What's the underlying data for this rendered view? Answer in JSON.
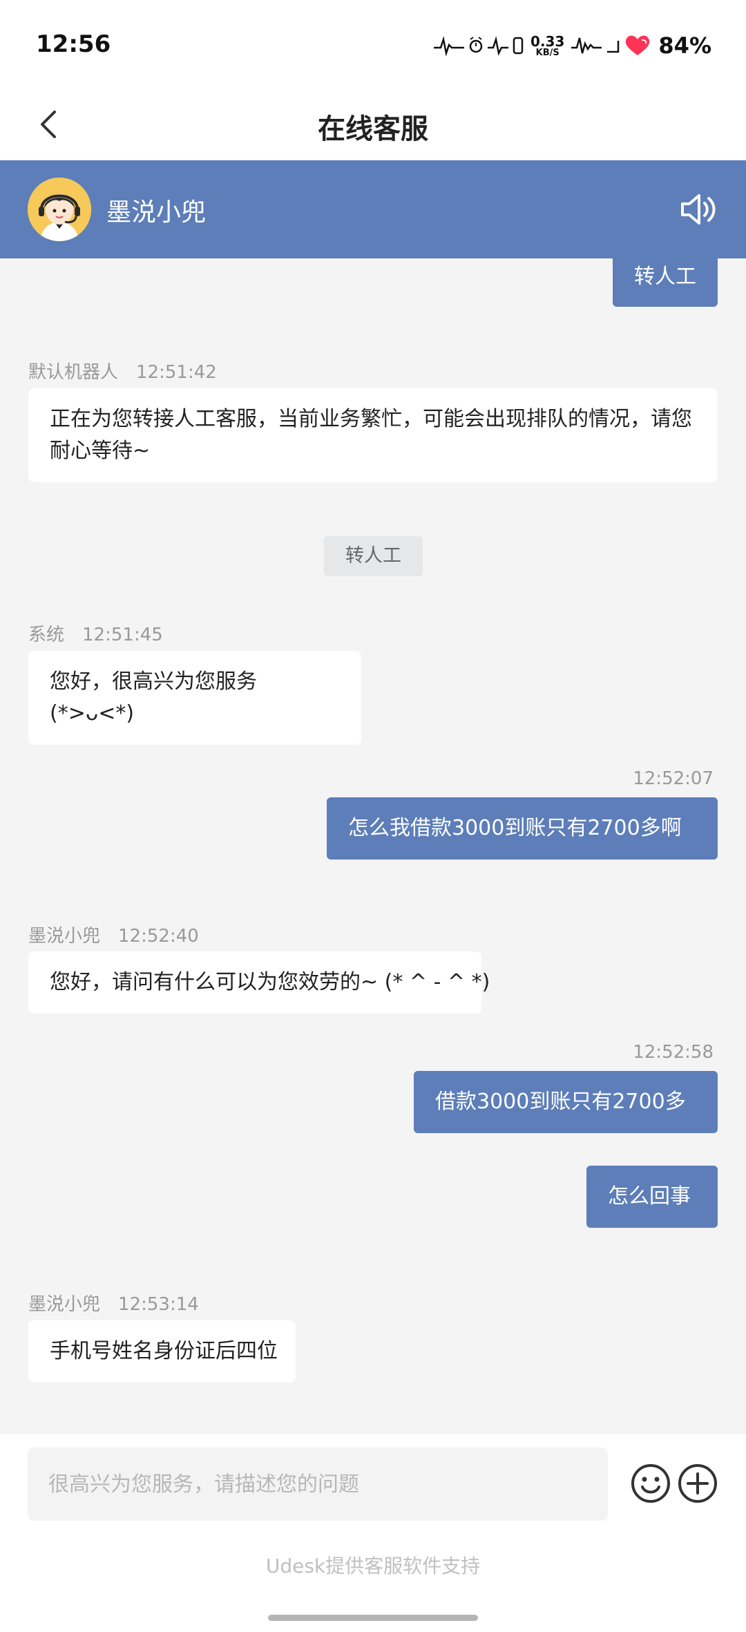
{
  "status_bar": {
    "time": "12:56",
    "net_speed_value": "0.33",
    "net_speed_unit": "KB/S",
    "battery": "84%"
  },
  "header": {
    "title": "在线客服",
    "back_icon": "chevron-left-icon"
  },
  "agent_bar": {
    "name": "墨涚小兜",
    "avatar_icon": "headset-agent-avatar",
    "speaker_icon": "speaker-icon",
    "color": "#5d7eb8"
  },
  "messages": [
    {
      "type": "user",
      "text": "转人工"
    },
    {
      "type": "agent",
      "sender": "默认机器人",
      "time": "12:51:42",
      "text": "正在为您转接人工客服，当前业务繁忙，可能会出现排队的情况，请您耐心等待~"
    },
    {
      "type": "system-tag",
      "text": "转人工"
    },
    {
      "type": "agent",
      "sender": "系统",
      "time": "12:51:45",
      "text": "您好，很高兴为您服务(*>ᴗ<*)"
    },
    {
      "type": "user",
      "time": "12:52:07",
      "text": "怎么我借款3000到账只有2700多啊"
    },
    {
      "type": "agent",
      "sender": "墨涚小兜",
      "time": "12:52:40",
      "text": "您好，请问有什么可以为您效劳的~ (* ^ - ^ *)"
    },
    {
      "type": "user",
      "time": "12:52:58",
      "text": "借款3000到账只有2700多"
    },
    {
      "type": "user",
      "text": "怎么回事"
    },
    {
      "type": "agent",
      "sender": "墨涚小兜",
      "time": "12:53:14",
      "text": "手机号姓名身份证后四位"
    }
  ],
  "input": {
    "placeholder": "很高兴为您服务，请描述您的问题",
    "value": "",
    "emoji_icon": "emoji-icon",
    "plus_icon": "plus-icon"
  },
  "footer": {
    "powered_by": "Udesk提供客服软件支持"
  }
}
